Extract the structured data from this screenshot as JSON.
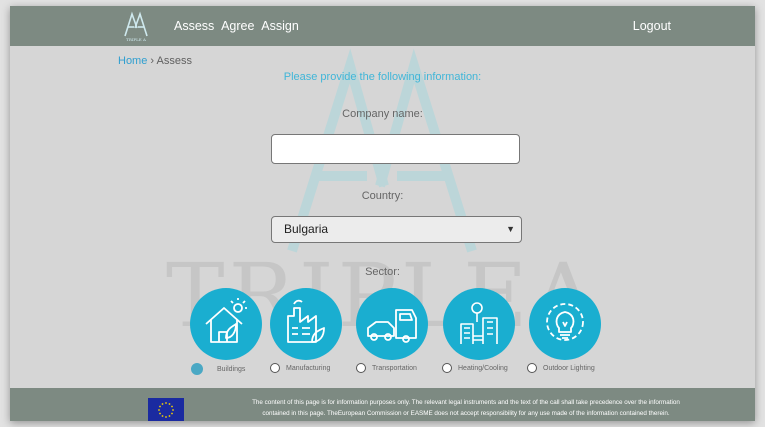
{
  "header": {
    "nav_items": [
      "Assess",
      "Agree",
      "Assign"
    ],
    "logout_label": "Logout",
    "logo_text": "TRIPLE A"
  },
  "watermark": {
    "text": "TRIPLEA"
  },
  "breadcrumb": {
    "home": "Home",
    "separator": "›",
    "current": "Assess"
  },
  "form": {
    "heading": "Please provide the following information:",
    "company_label": "Company name:",
    "company_value": "",
    "company_placeholder": "",
    "country_label": "Country:",
    "country_value": "Bulgaria",
    "sector_label": "Sector:"
  },
  "sectors": [
    {
      "label": "Buildings",
      "icon": "house-leaf-icon",
      "selected": true
    },
    {
      "label": "Manufacturing",
      "icon": "factory-leaf-icon",
      "selected": false
    },
    {
      "label": "Transportation",
      "icon": "car-truck-icon",
      "selected": false
    },
    {
      "label": "Heating/Cooling",
      "icon": "district-heating-icon",
      "selected": false
    },
    {
      "label": "Outdoor Lighting",
      "icon": "lightbulb-gear-icon",
      "selected": false
    }
  ],
  "footer": {
    "disclaimer_line1": "The content of this page is for information purposes only. The relevant legal instruments and the text of the call shall take precedence over the information",
    "disclaimer_line2": "contained in this page. TheEuropean Commission or EASME does not accept responsibility for any use made of the information contained therein."
  },
  "colors": {
    "bar": "#7d8a82",
    "accent": "#1aaed0",
    "link": "#2f9fd0",
    "page_bg": "#d6d6d6"
  }
}
